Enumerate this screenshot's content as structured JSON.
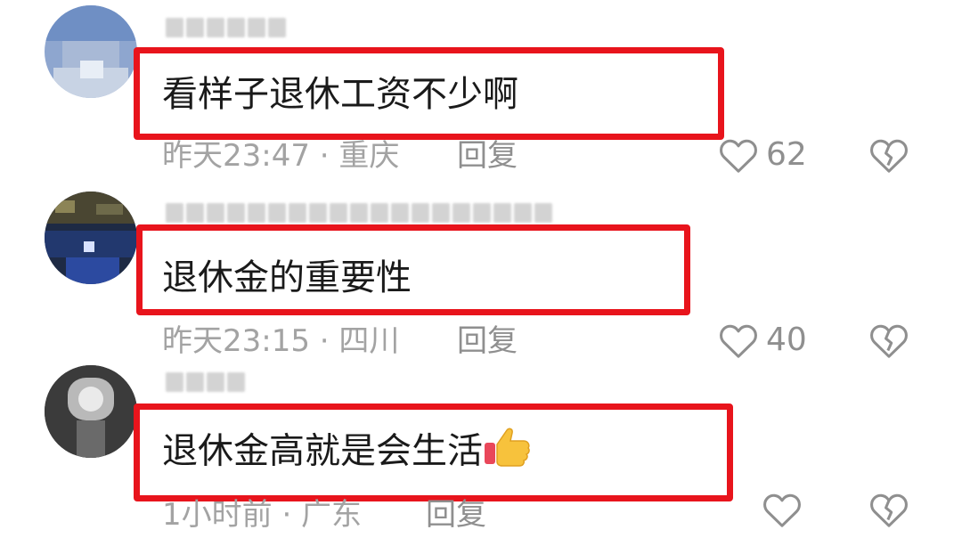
{
  "comments": [
    {
      "text": "看样子退休工资不少啊",
      "time": "昨天23:47 · 重庆",
      "reply_label": "回复",
      "likes": "62"
    },
    {
      "text": "退休金的重要性",
      "time": "昨天23:15 · 四川",
      "reply_label": "回复",
      "likes": "40"
    },
    {
      "text": "退休金高就是会生活",
      "emoji": "thumbs-up",
      "time": "1小时前 · 广东",
      "reply_label": "回复",
      "likes": ""
    }
  ],
  "colors": {
    "highlight": "#e8141c",
    "meta_text": "#a3a3a3",
    "body_text": "#1a1a1a",
    "icon": "#8f8f8f"
  }
}
